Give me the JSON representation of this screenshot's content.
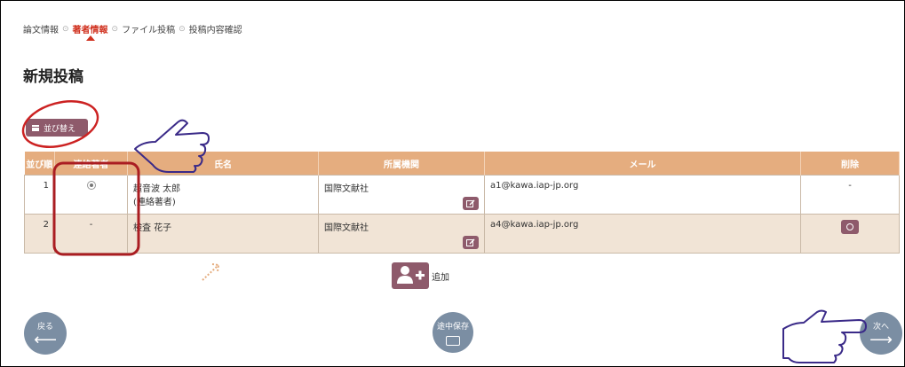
{
  "breadcrumb": {
    "steps": [
      "論文情報",
      "著者情報",
      "ファイル投稿",
      "投稿内容確認"
    ],
    "separator": "⊙"
  },
  "page_title": "新規投稿",
  "sort_button_label": "並び替え",
  "table": {
    "headers": [
      "並び順",
      "連絡著者",
      "氏名",
      "所属機関",
      "メール",
      "削除"
    ],
    "rows": [
      {
        "order": "1",
        "contact": "radio-selected",
        "name": "超音波 太郎",
        "name_note": "(連絡著者)",
        "affiliation": "国際文献社",
        "email": "a1@kawa.iap-jp.org",
        "delete": "-"
      },
      {
        "order": "2",
        "contact": "-",
        "name": "検査 花子",
        "name_note": "",
        "affiliation": "国際文献社",
        "email": "a4@kawa.iap-jp.org",
        "delete": "delete-button"
      }
    ]
  },
  "add_label": "追加",
  "nav": {
    "back_label": "戻る",
    "save_label": "途中保存",
    "next_label": "次へ"
  },
  "colors": {
    "header_bg": "#e5ad7f",
    "button": "#8e5a6b",
    "nav_circle": "#7b8ea3",
    "active_step": "#d0311f",
    "annotation": "#cc2222",
    "pointer": "#3a2a88"
  }
}
